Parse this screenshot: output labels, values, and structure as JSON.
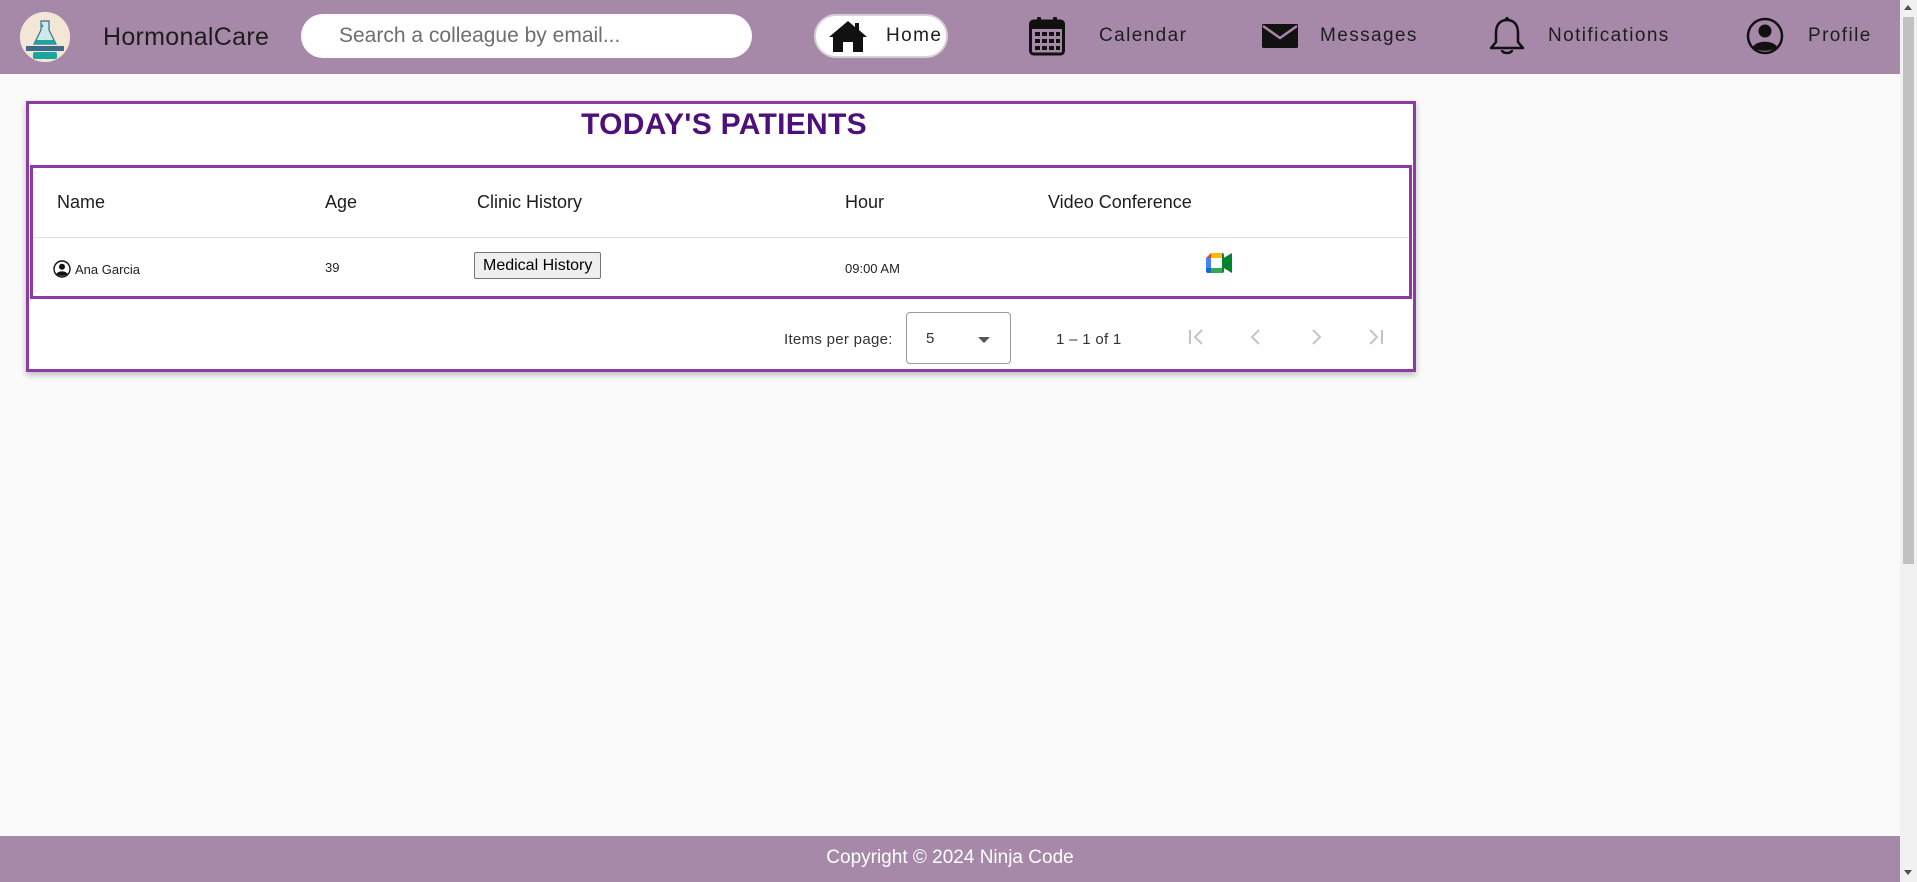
{
  "header": {
    "brand": "HormonalCare",
    "logo_text": "HORMONAL care",
    "search_placeholder": "Search a colleague by email...",
    "nav": [
      {
        "label": "Home",
        "icon": "home-icon",
        "active": true
      },
      {
        "label": "Calendar",
        "icon": "calendar-icon"
      },
      {
        "label": "Messages",
        "icon": "envelope-icon"
      },
      {
        "label": "Notifications",
        "icon": "bell-icon"
      },
      {
        "label": "Profile",
        "icon": "account-circle-icon"
      }
    ]
  },
  "patients": {
    "title": "TODAY'S PATIENTS",
    "columns": [
      "Name",
      "Age",
      "Clinic History",
      "Hour",
      "Video Conference"
    ],
    "rows": [
      {
        "name": "Ana Garcia",
        "age": "39",
        "clinic_history": "Medical History",
        "hour": "09:00 AM",
        "video_icon": "google-meet-icon"
      }
    ]
  },
  "paginator": {
    "items_per_page_label": "Items per page:",
    "page_size": "5",
    "range": "1 – 1 of 1"
  },
  "footer": {
    "text": "Copyright © 2024 Ninja Code"
  },
  "colors": {
    "nav_bg": "#a689a8",
    "card_border": "#8e3aa2",
    "title_color": "#4d0f7a",
    "page_bg": "#fafafa"
  }
}
